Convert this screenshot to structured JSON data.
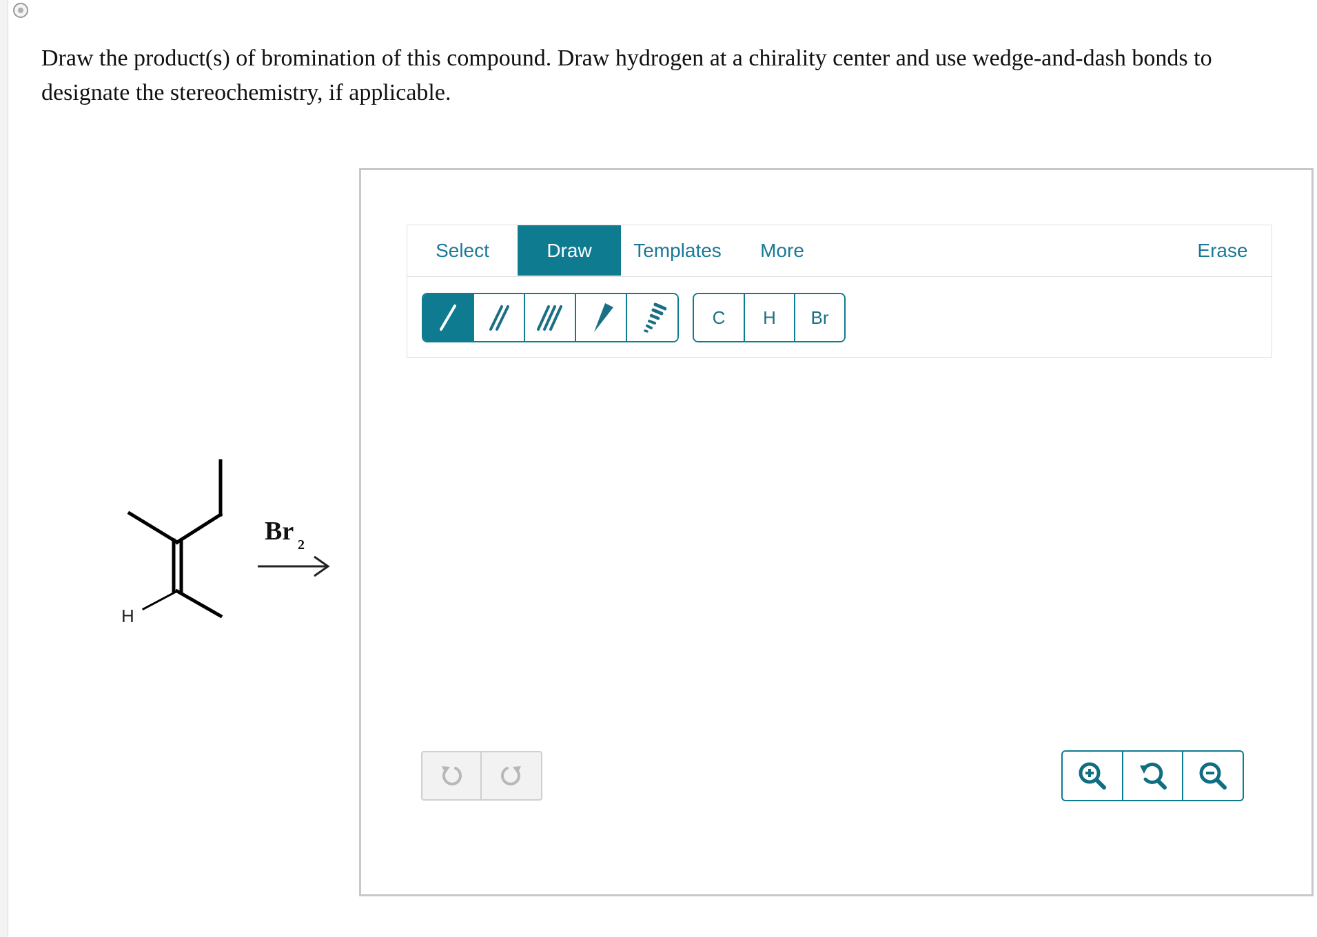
{
  "question": {
    "text": "Draw the product(s) of bromination of this compound. Draw hydrogen at a chirality center and use wedge-and-dash bonds to designate the stereochemistry, if applicable."
  },
  "reaction": {
    "hydrogen_label": "H",
    "reagent_main": "Br",
    "reagent_subscript": "2"
  },
  "toolbar": {
    "tabs": [
      {
        "label": "Select",
        "active": false
      },
      {
        "label": "Draw",
        "active": true
      },
      {
        "label": "Templates",
        "active": false
      },
      {
        "label": "More",
        "active": false
      }
    ],
    "erase_label": "Erase",
    "bond_tools": [
      {
        "icon": "single-bond-icon",
        "active": true
      },
      {
        "icon": "double-bond-icon",
        "active": false
      },
      {
        "icon": "triple-bond-icon",
        "active": false
      },
      {
        "icon": "wedge-bond-icon",
        "active": false
      },
      {
        "icon": "dash-bond-icon",
        "active": false
      }
    ],
    "atoms": [
      "C",
      "H",
      "Br"
    ]
  },
  "history": {
    "icons": [
      "undo-icon",
      "redo-icon"
    ]
  },
  "zoom": {
    "icons": [
      "zoom-in-icon",
      "zoom-reset-icon",
      "zoom-out-icon"
    ]
  },
  "colors": {
    "accent": "#0f7b91",
    "tab_text": "#1a7a96",
    "disabled_gray": "#b8b8b8"
  }
}
